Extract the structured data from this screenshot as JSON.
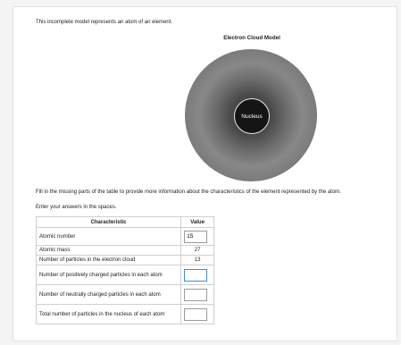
{
  "intro_text": "This incomplete model represents an atom of an element.",
  "model": {
    "title": "Electron Cloud Model",
    "nucleus_label": "Nucleus"
  },
  "instructions": {
    "line1": "Fill in the missing parts of the table to provide more information about the characteristics of the element represented by the atom.",
    "line2": "Enter your answers in the spaces."
  },
  "table": {
    "headers": [
      "Characteristic",
      "Value"
    ],
    "rows": [
      {
        "label": "Atomic number",
        "value": "15",
        "type": "input"
      },
      {
        "label": "Atomic mass",
        "value": "27",
        "type": "static"
      },
      {
        "label": "Number of particles in the electron cloud",
        "value": "13",
        "type": "static"
      },
      {
        "label": "Number of positively charged particles in each atom",
        "value": "",
        "type": "input"
      },
      {
        "label": "Number of neutrally charged particles in each atom",
        "value": "",
        "type": "input"
      },
      {
        "label": "Total number of particles in the nucleus of each atom",
        "value": "",
        "type": "input"
      }
    ]
  },
  "colors": {
    "focus_border": "#3a8fd6",
    "nucleus": "#151515"
  }
}
